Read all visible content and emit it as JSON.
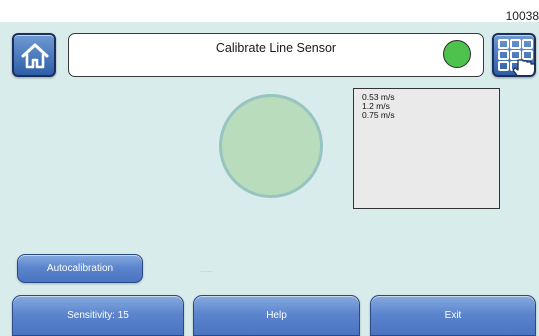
{
  "screen_id": "10038",
  "header": {
    "title": "Calibrate Line Sensor",
    "status_led_color": "#4dc24d"
  },
  "icons": {
    "home": "home-icon",
    "menu": "menu-grid-hand-icon"
  },
  "sensor": {
    "circle_color": "#b8dcbc"
  },
  "speed_panel": {
    "lines": [
      "0.53 m/s",
      "1.2 m/s",
      "0.75 m/s"
    ]
  },
  "buttons": {
    "autocalibration": "Autocalibration",
    "sensitivity": "Sensitivity: 15",
    "help": "Help",
    "exit": "Exit"
  },
  "colors": {
    "background": "#d9ecec",
    "button_blue": "#5a84cc",
    "button_border": "#2a4a86"
  }
}
